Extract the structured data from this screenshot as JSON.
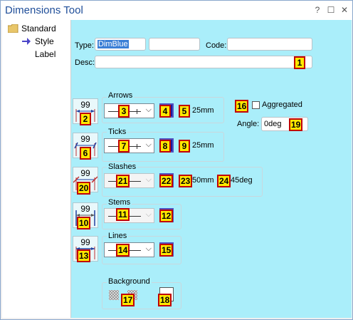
{
  "window": {
    "title": "Dimensions Tool",
    "help_icon": "?",
    "restore_icon": "☐",
    "close_icon": "✕"
  },
  "tree": {
    "items": [
      {
        "label": "Standard",
        "icon": "folder-icon"
      },
      {
        "label": "Style",
        "icon": "arrow-right-icon"
      },
      {
        "label": "Label",
        "icon": ""
      }
    ]
  },
  "form": {
    "type_label": "Type:",
    "type_value": "DimBlue",
    "type_extra_value": "",
    "code_label": "Code:",
    "code_value": "",
    "desc_label": "Desc:",
    "desc_value": ""
  },
  "groups": {
    "arrows": {
      "title": "Arrows",
      "size": "25mm"
    },
    "ticks": {
      "title": "Ticks",
      "size": "25mm"
    },
    "slashes": {
      "title": "Slashes",
      "size": "50mm",
      "angle": "45deg"
    },
    "stems": {
      "title": "Stems"
    },
    "lines": {
      "title": "Lines"
    },
    "background": {
      "title": "Background"
    }
  },
  "icon_buttons": [
    "99",
    "99",
    "99",
    "99",
    "99"
  ],
  "aggregated": {
    "label": "Aggregated",
    "checked": false
  },
  "angle": {
    "label": "Angle:",
    "value": "0deg"
  },
  "badges": [
    "1",
    "2",
    "3",
    "4",
    "5",
    "6",
    "7",
    "8",
    "9",
    "10",
    "11",
    "12",
    "13",
    "14",
    "15",
    "16",
    "17",
    "18",
    "19",
    "20",
    "21",
    "22",
    "23",
    "24"
  ],
  "colors": {
    "accent": "#1f4e99",
    "panel": "#aaeefa",
    "badge_fill": "#ffe800",
    "badge_border": "#c00000",
    "swatch": "#1a1aa0"
  }
}
